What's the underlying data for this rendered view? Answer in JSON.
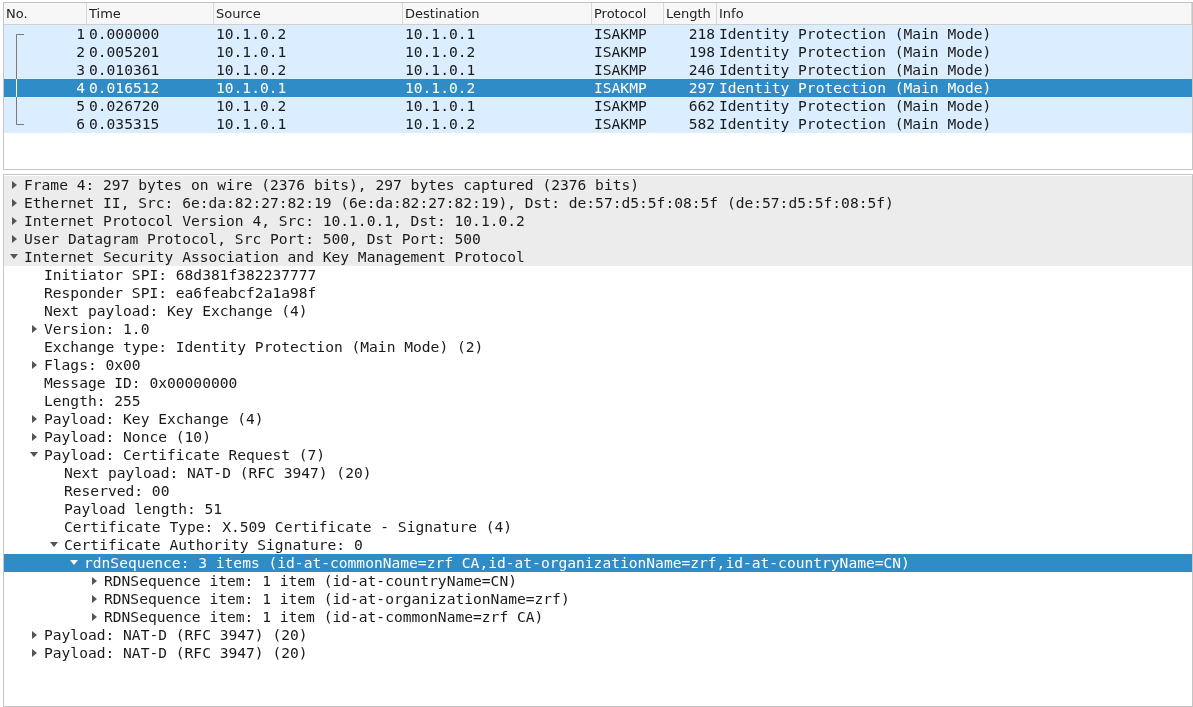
{
  "packet_list": {
    "columns": [
      "No.",
      "Time",
      "Source",
      "Destination",
      "Protocol",
      "Length",
      "Info"
    ],
    "rows": [
      {
        "no": "1",
        "time": "0.000000",
        "source": "10.1.0.2",
        "destination": "10.1.0.1",
        "protocol": "ISAKMP",
        "length": "218",
        "info": "Identity Protection (Main Mode)",
        "selected": false
      },
      {
        "no": "2",
        "time": "0.005201",
        "source": "10.1.0.1",
        "destination": "10.1.0.2",
        "protocol": "ISAKMP",
        "length": "198",
        "info": "Identity Protection (Main Mode)",
        "selected": false
      },
      {
        "no": "3",
        "time": "0.010361",
        "source": "10.1.0.2",
        "destination": "10.1.0.1",
        "protocol": "ISAKMP",
        "length": "246",
        "info": "Identity Protection (Main Mode)",
        "selected": false
      },
      {
        "no": "4",
        "time": "0.016512",
        "source": "10.1.0.1",
        "destination": "10.1.0.2",
        "protocol": "ISAKMP",
        "length": "297",
        "info": "Identity Protection (Main Mode)",
        "selected": true
      },
      {
        "no": "5",
        "time": "0.026720",
        "source": "10.1.0.2",
        "destination": "10.1.0.1",
        "protocol": "ISAKMP",
        "length": "662",
        "info": "Identity Protection (Main Mode)",
        "selected": false
      },
      {
        "no": "6",
        "time": "0.035315",
        "source": "10.1.0.1",
        "destination": "10.1.0.2",
        "protocol": "ISAKMP",
        "length": "582",
        "info": "Identity Protection (Main Mode)",
        "selected": false
      }
    ]
  },
  "packet_details": [
    {
      "label": "Frame 4: 297 bytes on wire (2376 bits), 297 bytes captured (2376 bits)",
      "expanded": false,
      "selected": false
    },
    {
      "label": "Ethernet II, Src: 6e:da:82:27:82:19 (6e:da:82:27:82:19), Dst: de:57:d5:5f:08:5f (de:57:d5:5f:08:5f)",
      "expanded": false,
      "selected": false
    },
    {
      "label": "Internet Protocol Version 4, Src: 10.1.0.1, Dst: 10.1.0.2",
      "expanded": false,
      "selected": false
    },
    {
      "label": "User Datagram Protocol, Src Port: 500, Dst Port: 500",
      "expanded": false,
      "selected": false
    },
    {
      "label": "Internet Security Association and Key Management Protocol",
      "expanded": true,
      "selected": false,
      "children": [
        {
          "label": "Initiator SPI: 68d381f382237777",
          "selected": false
        },
        {
          "label": "Responder SPI: ea6feabcf2a1a98f",
          "selected": false
        },
        {
          "label": "Next payload: Key Exchange (4)",
          "selected": false
        },
        {
          "label": "Version: 1.0",
          "expanded": false,
          "selected": false
        },
        {
          "label": "Exchange type: Identity Protection (Main Mode) (2)",
          "selected": false
        },
        {
          "label": "Flags: 0x00",
          "expanded": false,
          "selected": false
        },
        {
          "label": "Message ID: 0x00000000",
          "selected": false
        },
        {
          "label": "Length: 255",
          "selected": false
        },
        {
          "label": "Payload: Key Exchange (4)",
          "expanded": false,
          "selected": false
        },
        {
          "label": "Payload: Nonce (10)",
          "expanded": false,
          "selected": false
        },
        {
          "label": "Payload: Certificate Request (7)",
          "expanded": true,
          "selected": false,
          "children": [
            {
              "label": "Next payload: NAT-D (RFC 3947) (20)",
              "selected": false
            },
            {
              "label": "Reserved: 00",
              "selected": false
            },
            {
              "label": "Payload length: 51",
              "selected": false
            },
            {
              "label": "Certificate Type: X.509 Certificate - Signature (4)",
              "selected": false
            },
            {
              "label": "Certificate Authority Signature: 0",
              "expanded": true,
              "selected": false,
              "children": [
                {
                  "label": "rdnSequence: 3 items (id-at-commonName=zrf CA,id-at-organizationName=zrf,id-at-countryName=CN)",
                  "expanded": true,
                  "selected": true,
                  "children": [
                    {
                      "label": "RDNSequence item: 1 item (id-at-countryName=CN)",
                      "expanded": false,
                      "selected": false
                    },
                    {
                      "label": "RDNSequence item: 1 item (id-at-organizationName=zrf)",
                      "expanded": false,
                      "selected": false
                    },
                    {
                      "label": "RDNSequence item: 1 item (id-at-commonName=zrf CA)",
                      "expanded": false,
                      "selected": false
                    }
                  ]
                }
              ]
            }
          ]
        },
        {
          "label": "Payload: NAT-D (RFC 3947) (20)",
          "expanded": false,
          "selected": false
        },
        {
          "label": "Payload: NAT-D (RFC 3947) (20)",
          "expanded": false,
          "selected": false
        }
      ]
    }
  ]
}
